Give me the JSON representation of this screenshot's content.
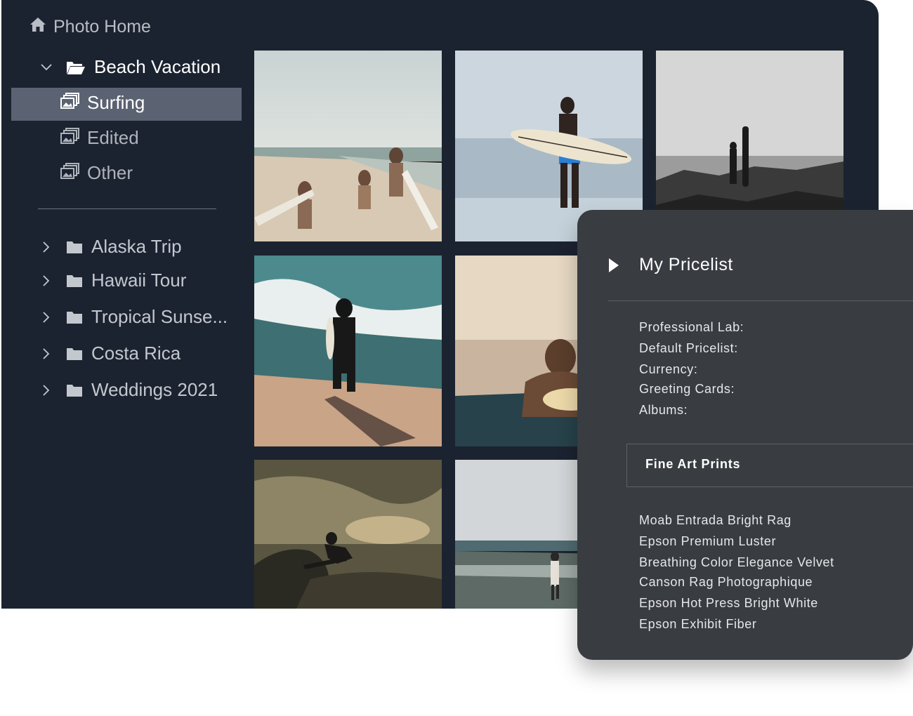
{
  "sidebar": {
    "home_label": "Photo Home",
    "open_folder": {
      "label": "Beach Vacation"
    },
    "sub_items": [
      {
        "label": "Surfing"
      },
      {
        "label": "Edited"
      },
      {
        "label": "Other"
      }
    ],
    "folders": [
      {
        "label": "Alaska Trip"
      },
      {
        "label": "Hawaii Tour"
      },
      {
        "label": "Tropical Sunse..."
      },
      {
        "label": "Costa Rica"
      },
      {
        "label": "Weddings 2021"
      }
    ]
  },
  "pricelist": {
    "title": "My Pricelist",
    "fields": [
      {
        "label": "Professional Lab:"
      },
      {
        "label": "Default Pricelist:"
      },
      {
        "label": "Currency:"
      },
      {
        "label": "Greeting Cards:"
      },
      {
        "label": "Albums:"
      }
    ],
    "category_selected": "Fine Art Prints",
    "papers": [
      "Moab Entrada Bright Rag",
      "Epson Premium Luster",
      "Breathing Color Elegance Velvet",
      "Canson Rag Photographique",
      "Epson Hot Press Bright White",
      "Epson Exhibit Fiber"
    ]
  },
  "colors": {
    "app_bg": "#1c2330",
    "selected_row": "#5b6271",
    "panel_bg": "#393c41"
  }
}
